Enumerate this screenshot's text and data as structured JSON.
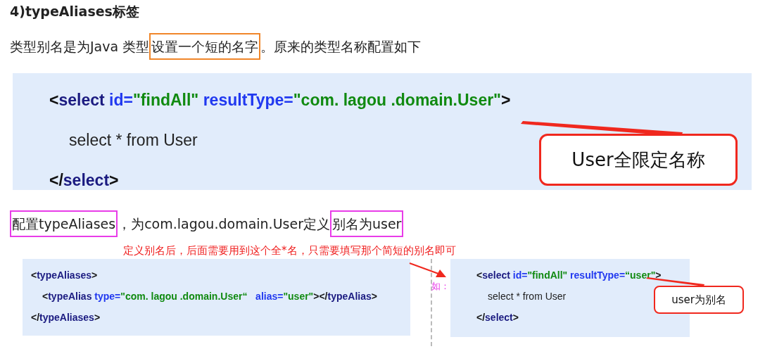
{
  "heading": "4)typeAliases标签",
  "intro": [
    {
      "text": "类型别名是为Java 类型"
    },
    {
      "text": "设置一个短的名字",
      "color": "#f0862a"
    },
    {
      "text": "。原来的类型名称配置如下"
    }
  ],
  "original_code": {
    "lines": [
      {
        "indent": false,
        "tokens": [
          {
            "kind": "punct",
            "text": "<"
          },
          {
            "kind": "tag",
            "text": "select"
          },
          {
            "kind": "attr",
            "text": " id="
          },
          {
            "kind": "value",
            "text": "\"findAll\""
          },
          {
            "kind": "attr",
            "text": " resultType="
          },
          {
            "kind": "value",
            "text": "\"com. lagou .domain.User\""
          },
          {
            "kind": "punct",
            "text": ">"
          }
        ]
      },
      {
        "indent": true,
        "tokens": [
          {
            "kind": "plain",
            "text": "select * from User"
          }
        ]
      },
      {
        "indent": false,
        "tokens": [
          {
            "kind": "punct",
            "text": "</"
          },
          {
            "kind": "tag",
            "text": "select"
          },
          {
            "kind": "punct",
            "text": ">"
          }
        ]
      }
    ],
    "callout": "User全限定名称"
  },
  "config_line": [
    {
      "text": "配置typeAliases",
      "color": "#e83ce8"
    },
    {
      "text": "，为com.lagou.domain.User定义"
    },
    {
      "text": "别名为user ",
      "color": "#e83ce8"
    }
  ],
  "note": "定义别名后，后面需要用到这个全*名，只需要填写那个简短的别名即可",
  "alias_code": {
    "lines": [
      {
        "indent": false,
        "tokens": [
          {
            "kind": "punct",
            "text": "<"
          },
          {
            "kind": "tag",
            "text": "typeAliases"
          },
          {
            "kind": "punct",
            "text": ">"
          }
        ]
      },
      {
        "indent": true,
        "tokens": [
          {
            "kind": "punct",
            "text": "<"
          },
          {
            "kind": "tag",
            "text": "typeAlias"
          },
          {
            "kind": "attr",
            "text": " type="
          },
          {
            "kind": "value",
            "text": "\"com. lagou .domain.User“"
          },
          {
            "kind": "attr",
            "text": "   alias="
          },
          {
            "kind": "value",
            "text": "\"user\""
          },
          {
            "kind": "punct",
            "text": "></"
          },
          {
            "kind": "tag",
            "text": "typeAlias"
          },
          {
            "kind": "punct",
            "text": ">"
          }
        ]
      },
      {
        "indent": false,
        "tokens": [
          {
            "kind": "punct",
            "text": "</"
          },
          {
            "kind": "tag",
            "text": "typeAliases"
          },
          {
            "kind": "punct",
            "text": ">"
          }
        ]
      }
    ]
  },
  "example_label": "如：",
  "example_code": {
    "lines": [
      {
        "indent": false,
        "tokens": [
          {
            "kind": "punct",
            "text": "<"
          },
          {
            "kind": "tag",
            "text": "select"
          },
          {
            "kind": "attr",
            "text": " id="
          },
          {
            "kind": "value",
            "text": "\"findAll\""
          },
          {
            "kind": "attr",
            "text": " resultType="
          },
          {
            "kind": "value",
            "text": "“user\""
          },
          {
            "kind": "punct",
            "text": ">"
          }
        ]
      },
      {
        "indent": true,
        "tokens": [
          {
            "kind": "plain",
            "text": "select * from User"
          }
        ]
      },
      {
        "indent": false,
        "tokens": [
          {
            "kind": "punct",
            "text": "</"
          },
          {
            "kind": "tag",
            "text": "select"
          },
          {
            "kind": "punct",
            "text": ">"
          }
        ]
      }
    ],
    "callout": "user为别名"
  }
}
